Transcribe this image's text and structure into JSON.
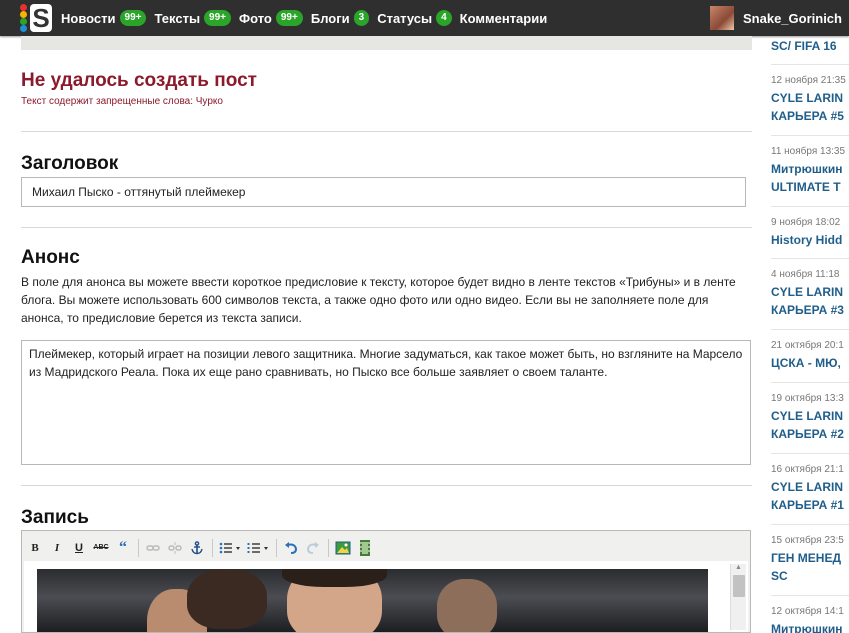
{
  "topbar": {
    "logo_letter": "S",
    "logo_dot_colors": [
      "#e8322f",
      "#f7b500",
      "#2aa52a",
      "#1d8fd6"
    ],
    "nav": [
      {
        "label": "Новости",
        "badge": "99+"
      },
      {
        "label": "Тексты",
        "badge": "99+"
      },
      {
        "label": "Фото",
        "badge": "99+"
      },
      {
        "label": "Блоги",
        "badge": "3"
      },
      {
        "label": "Статусы",
        "badge": "4"
      },
      {
        "label": "Комментарии",
        "badge": ""
      }
    ],
    "username": "Snake_Gorinich"
  },
  "error": {
    "title": "Не удалось создать пост",
    "message": "Текст содержит запрещенные слова: Чурко"
  },
  "form": {
    "title_heading": "Заголовок",
    "title_value": "Михаил Пыско - оттянутый плеймекер",
    "anons_heading": "Анонс",
    "anons_help": "В поле для анонса вы можете ввести короткое предисловие к тексту, которое будет видно в ленте текстов «Трибуны» и в ленте блога. Вы можете использовать 600 символов текста, а также одно фото или одно видео. Если вы не заполняете поле для анонса, то предисловие берется из текста записи.",
    "anons_value": "Плеймекер, который играет на позиции левого защитника. Многие задуматься, как такое может быть, но взгляните на Марсело из Мадридского Реала. Пока их еще рано сравнивать, но Пыско все больше заявляет о своем таланте.",
    "body_heading": "Запись"
  },
  "toolbar": {
    "bold": "B",
    "italic": "I",
    "underline": "U",
    "strike": "ABC",
    "quote": "“"
  },
  "sidebar": {
    "items": [
      {
        "date": "",
        "title": "SC/ FIFA 16"
      },
      {
        "date": "12 ноября 21:35",
        "title": "CYLE LARIN",
        "title2": "КАРЬЕРА #5"
      },
      {
        "date": "11 ноября 13:35",
        "title": "Митрюшкин",
        "title2": "ULTIMATE T"
      },
      {
        "date": "9 ноября 18:02",
        "title": "History Hidd"
      },
      {
        "date": "4 ноября 11:18",
        "title": "CYLE LARIN",
        "title2": "КАРЬЕРА #3"
      },
      {
        "date": "21 октября 20:1",
        "title": "ЦСКА - МЮ,"
      },
      {
        "date": "19 октября 13:3",
        "title": "CYLE LARIN",
        "title2": "КАРЬЕРА #2"
      },
      {
        "date": "16 октября 21:1",
        "title": "CYLE LARIN",
        "title2": "КАРЬЕРА #1"
      },
      {
        "date": "15 октября 23:5",
        "title": "ГЕН МЕНЕД",
        "title2": "SC"
      },
      {
        "date": "12 октября 14:1",
        "title": "Митрюшкин"
      }
    ]
  }
}
